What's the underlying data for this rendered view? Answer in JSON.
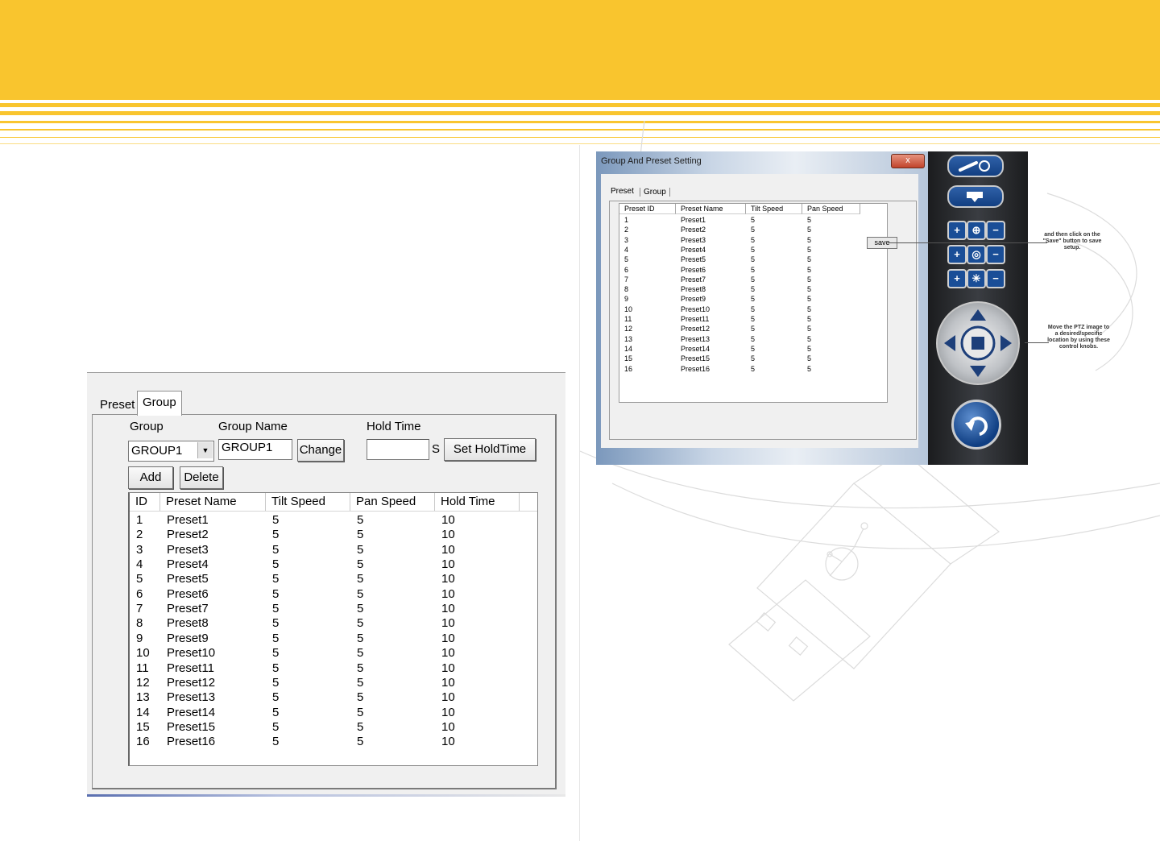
{
  "group_dialog": {
    "tabs": [
      {
        "label": "Preset",
        "active": false
      },
      {
        "label": "Group",
        "active": true
      }
    ],
    "labels": {
      "group": "Group",
      "group_name": "Group Name",
      "hold_time": "Hold Time",
      "seconds_unit": "S"
    },
    "group_select": {
      "value": "GROUP1"
    },
    "group_name_input": {
      "value": "GROUP1"
    },
    "hold_time_input": {
      "value": ""
    },
    "buttons": {
      "change": "Change",
      "set_hold_time": "Set HoldTime",
      "add": "Add",
      "delete": "Delete"
    },
    "columns": [
      "ID",
      "Preset Name",
      "Tilt Speed",
      "Pan Speed",
      "Hold Time"
    ],
    "rows": [
      [
        "1",
        "Preset1",
        "5",
        "5",
        "10"
      ],
      [
        "2",
        "Preset2",
        "5",
        "5",
        "10"
      ],
      [
        "3",
        "Preset3",
        "5",
        "5",
        "10"
      ],
      [
        "4",
        "Preset4",
        "5",
        "5",
        "10"
      ],
      [
        "5",
        "Preset5",
        "5",
        "5",
        "10"
      ],
      [
        "6",
        "Preset6",
        "5",
        "5",
        "10"
      ],
      [
        "7",
        "Preset7",
        "5",
        "5",
        "10"
      ],
      [
        "8",
        "Preset8",
        "5",
        "5",
        "10"
      ],
      [
        "9",
        "Preset9",
        "5",
        "5",
        "10"
      ],
      [
        "10",
        "Preset10",
        "5",
        "5",
        "10"
      ],
      [
        "11",
        "Preset11",
        "5",
        "5",
        "10"
      ],
      [
        "12",
        "Preset12",
        "5",
        "5",
        "10"
      ],
      [
        "13",
        "Preset13",
        "5",
        "5",
        "10"
      ],
      [
        "14",
        "Preset14",
        "5",
        "5",
        "10"
      ],
      [
        "15",
        "Preset15",
        "5",
        "5",
        "10"
      ],
      [
        "16",
        "Preset16",
        "5",
        "5",
        "10"
      ]
    ]
  },
  "preset_window": {
    "title": "Group And Preset Setting",
    "close_label": "x",
    "tabs": [
      {
        "label": "Preset",
        "active": true
      },
      {
        "label": "Group",
        "active": false
      }
    ],
    "columns": [
      "Preset ID",
      "Preset Name",
      "Tilt Speed",
      "Pan Speed"
    ],
    "rows": [
      [
        "1",
        "Preset1",
        "5",
        "5"
      ],
      [
        "2",
        "Preset2",
        "5",
        "5"
      ],
      [
        "3",
        "Preset3",
        "5",
        "5"
      ],
      [
        "4",
        "Preset4",
        "5",
        "5"
      ],
      [
        "5",
        "Preset5",
        "5",
        "5"
      ],
      [
        "6",
        "Preset6",
        "5",
        "5"
      ],
      [
        "7",
        "Preset7",
        "5",
        "5"
      ],
      [
        "8",
        "Preset8",
        "5",
        "5"
      ],
      [
        "9",
        "Preset9",
        "5",
        "5"
      ],
      [
        "10",
        "Preset10",
        "5",
        "5"
      ],
      [
        "11",
        "Preset11",
        "5",
        "5"
      ],
      [
        "12",
        "Preset12",
        "5",
        "5"
      ],
      [
        "13",
        "Preset13",
        "5",
        "5"
      ],
      [
        "14",
        "Preset14",
        "5",
        "5"
      ],
      [
        "15",
        "Preset15",
        "5",
        "5"
      ],
      [
        "16",
        "Preset16",
        "5",
        "5"
      ]
    ],
    "save_label": "save"
  },
  "annotations": {
    "save_note": "and then click on the \"Save\" button to save setup.",
    "move_note": "Move the PTZ image to a desired/specific location by using these control knobs."
  },
  "colors": {
    "header": "#f9c52e",
    "control_blue": "#1a4e97"
  }
}
